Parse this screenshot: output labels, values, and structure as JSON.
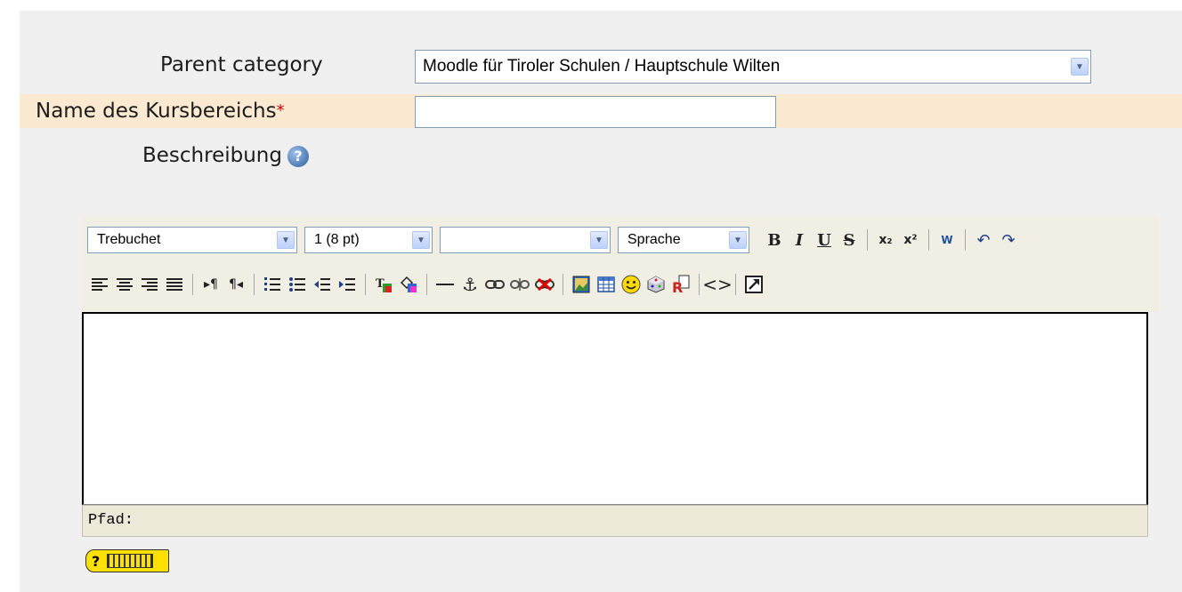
{
  "form": {
    "parent_label": "Parent category",
    "parent_value": "Moodle für Tiroler Schulen / Hauptschule Wilten",
    "name_label": "Name des Kursbereichs",
    "required_mark": "*",
    "name_value": "",
    "description_label": "Beschreibung",
    "help_icon": "?"
  },
  "editor": {
    "font_select": "Trebuchet",
    "size_select": "1 (8 pt)",
    "style_select": "",
    "lang_select": "Sprache",
    "status_path": "Pfad:",
    "content": ""
  },
  "toolbar": {
    "row1_buttons": [
      {
        "name": "bold-icon",
        "glyph": "B"
      },
      {
        "name": "italic-icon",
        "glyph": "I"
      },
      {
        "name": "underline-icon",
        "glyph": "U"
      },
      {
        "name": "strikethrough-icon",
        "glyph": "S"
      },
      {
        "name": "subscript-icon",
        "glyph": "x₂"
      },
      {
        "name": "superscript-icon",
        "glyph": "x²"
      },
      {
        "name": "paste-word-icon",
        "glyph": "W"
      },
      {
        "name": "undo-icon",
        "glyph": "↶"
      },
      {
        "name": "redo-icon",
        "glyph": "↷"
      }
    ]
  },
  "colors": {
    "panel_bg": "#f0f0f0",
    "required_row_bg": "#fbe9d2",
    "toolbar_bg": "#f1eee4",
    "status_bg": "#ece9d8",
    "required_star": "#cc0000"
  }
}
